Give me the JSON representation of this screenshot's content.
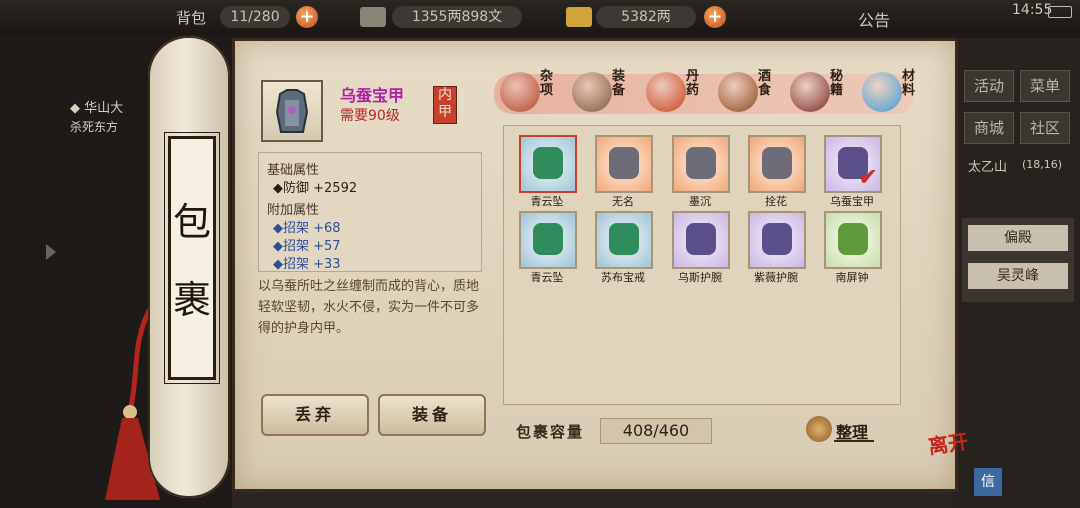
{
  "topbar": {
    "bag_count": "11/280",
    "silver": "1355两898文",
    "gold": "5382两",
    "notice": "公告",
    "time": "14:55"
  },
  "left_quest": {
    "title": "◆ 华山大",
    "line2": "杀死东方"
  },
  "right_panel": {
    "buttons": [
      "活动",
      "菜单",
      "商城",
      "社区"
    ],
    "location": "太乙山",
    "coords": "(18,16)",
    "places": [
      "偏殿",
      "吴灵峰"
    ],
    "bottom_btn": "信"
  },
  "scroll": {
    "chars": [
      "包",
      "裹"
    ]
  },
  "item": {
    "name": "乌蚕宝甲",
    "req": "需要90级",
    "slot_tag": [
      "内",
      "甲"
    ],
    "base_title": "基础属性",
    "base_stats": [
      "◆防御  +2592"
    ],
    "extra_title": "附加属性",
    "extra_stats": [
      "◆招架  +68",
      "◆招架  +57",
      "◆招架  +33"
    ],
    "desc": "以乌蚕所吐之丝缠制而成的背心，质地轻软坚韧，水火不侵，实为一件不可多得的护身内甲。"
  },
  "buttons": {
    "discard": "丢弃",
    "equip": "装备"
  },
  "categories": [
    {
      "label": "杂项",
      "icon": "pot-icon",
      "color": "#b4462b"
    },
    {
      "label": "装备",
      "icon": "weapon-icon",
      "color": "#7a5a3a"
    },
    {
      "label": "丹药",
      "icon": "pill-icon",
      "color": "#c9441d"
    },
    {
      "label": "酒食",
      "icon": "jar-icon",
      "color": "#8b4a1e"
    },
    {
      "label": "秘籍",
      "icon": "book-icon",
      "color": "#7a2d2a"
    },
    {
      "label": "材料",
      "icon": "crystal-icon",
      "color": "#3b9bd6"
    }
  ],
  "items": [
    {
      "label": "青云坠",
      "style": "teal",
      "icon": "jade-pendant-icon",
      "selected": true
    },
    {
      "label": "无名",
      "style": "orange",
      "icon": "dagger-icon"
    },
    {
      "label": "墨沉",
      "style": "orange",
      "icon": "dagger-icon"
    },
    {
      "label": "拴花",
      "style": "orange",
      "icon": "flower-weapon-icon"
    },
    {
      "label": "乌蚕宝甲",
      "style": "purple",
      "icon": "armor-icon",
      "checked": true
    },
    {
      "label": "青云坠",
      "style": "teal",
      "icon": "jade-pendant-icon"
    },
    {
      "label": "苏布宝戒",
      "style": "teal",
      "icon": "ring-icon"
    },
    {
      "label": "乌斯护腕",
      "style": "purple",
      "icon": "bracer-icon"
    },
    {
      "label": "紫薇护腕",
      "style": "purple",
      "icon": "bracer-icon"
    },
    {
      "label": "南屏钟",
      "style": "green",
      "icon": "bell-icon"
    }
  ],
  "capacity": {
    "label": "包裹容量",
    "value": "408/460"
  },
  "sort_label": "整理",
  "leave_label": "离开"
}
